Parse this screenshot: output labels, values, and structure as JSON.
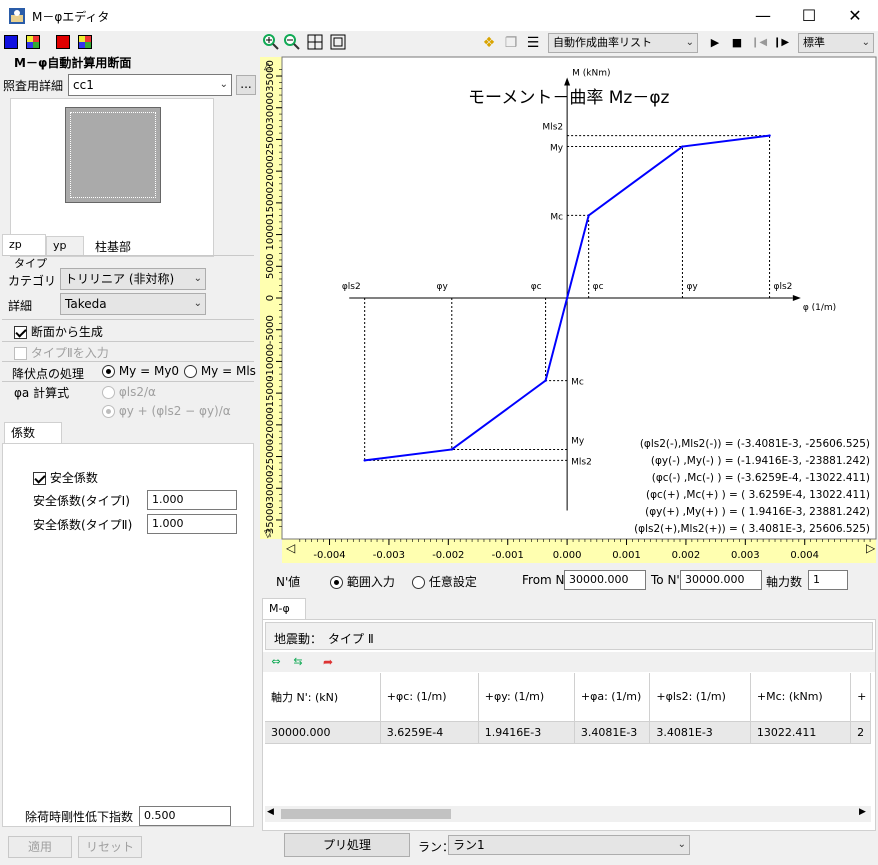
{
  "window": {
    "title": "M－φエディタ"
  },
  "left": {
    "group_title": "M－φ自動計算用断面",
    "ref_detail_label": "照査用詳細",
    "ref_detail_value": "cc1",
    "browse_label": "...",
    "section_caption": "柱基部",
    "axis_tabs": [
      "zp",
      "yp"
    ],
    "type_label": "タイプ",
    "category_label": "カテゴリ",
    "category_value": "トリリニア (非対称)",
    "detail_label": "詳細",
    "detail_value": "Takeda",
    "gen_from_section_label": "断面から生成",
    "type2_input_label": "タイプⅡを入力",
    "yield_label": "降伏点の処理",
    "yield_opt1": "My = My0",
    "yield_opt2": "My = Mls",
    "phia_label": "φa 計算式",
    "phia_opt1": "φls2/α",
    "phia_opt2": "φy + (φls2 − φy)/α",
    "coef_tab": "係数",
    "safety_label": "安全係数",
    "safety1_label": "安全係数(タイプⅠ)",
    "safety1_value": "1.000",
    "safety2_label": "安全係数(タイプⅡ)",
    "safety2_value": "1.000",
    "unload_label": "除荷時剛性低下指数",
    "unload_value": "0.500",
    "apply_label": "適用",
    "reset_label": "リセット"
  },
  "toolbar": {
    "list_value": "自動作成曲率リスト",
    "mode_value": "標準"
  },
  "chart": {
    "title": "モーメント－曲率 Mz－φz",
    "y_axis_label": "M (kNm)",
    "x_axis_label": "φ (1/m)",
    "x_ticks": [
      "-0.004",
      "-0.003",
      "-0.002",
      "-0.001",
      "0.000",
      "0.001",
      "0.002",
      "0.003",
      "0.004"
    ],
    "y_ticks": [
      "-35000",
      "-30000",
      "-25000",
      "-20000",
      "-15000",
      "-10000",
      "-5000",
      "0",
      "5000",
      "10000",
      "15000",
      "20000",
      "25000",
      "30000",
      "35000"
    ],
    "point_labels_top": [
      "φls2",
      "φy",
      "φc",
      "φc",
      "φy",
      "φls2"
    ],
    "m_labels": [
      "Mls2",
      "My",
      "Mc",
      "Mc",
      "My",
      "Mls2"
    ],
    "legend_lines": [
      "(φls2(-),Mls2(-)) = (-3.4081E-3,  -25606.525)",
      "(φy(-)   ,My(-)   ) = (-1.9416E-3,  -23881.242)",
      "(φc(-)   ,Mc(-)   ) = (-3.6259E-4,  -13022.411)",
      "(φc(+)   ,Mc(+)   ) = ( 3.6259E-4,   13022.411)",
      "(φy(+)   ,My(+)   ) = ( 1.9416E-3,   23881.242)",
      "(φls2(+),Mls2(+)) = ( 3.4081E-3,   25606.525)"
    ]
  },
  "chart_data": {
    "type": "line",
    "title": "モーメント－曲率 Mz－φz",
    "xlabel": "φ (1/m)",
    "ylabel": "M (kNm)",
    "xlim": [
      -0.0048,
      0.0052
    ],
    "ylim": [
      -38000,
      38000
    ],
    "series": [
      {
        "x": [
          -0.0034081,
          -0.0019416,
          -0.00036259,
          0.0,
          0.00036259,
          0.0019416,
          0.0034081
        ],
        "y": [
          -25606.525,
          -23881.242,
          -13022.411,
          0.0,
          13022.411,
          23881.242,
          25606.525
        ],
        "color": "#0000ff"
      }
    ]
  },
  "nvalue": {
    "label": "N'値",
    "opt_range": "範囲入力",
    "opt_any": "任意設定",
    "from_label": "From N'",
    "from_value": "30000.000",
    "to_label": "To N'",
    "to_value": "30000.000",
    "count_label": "軸力数",
    "count_value": "1"
  },
  "lower": {
    "tab": "M-φ",
    "quake_label": "地震動：",
    "quake_value": "タイプ Ⅱ",
    "columns": [
      "軸力 N': (kN)",
      "+φc: (1/m)",
      "+φy: (1/m)",
      "+φa: (1/m)",
      "+φls2: (1/m)",
      "+Mc: (kNm)",
      "+"
    ],
    "rows": [
      [
        "30000.000",
        "3.6259E-4",
        "1.9416E-3",
        "3.4081E-3",
        "3.4081E-3",
        "13022.411",
        "2"
      ]
    ],
    "pre_button": "プリ処理",
    "run_label": "ラン：",
    "run_value": "ラン1"
  }
}
